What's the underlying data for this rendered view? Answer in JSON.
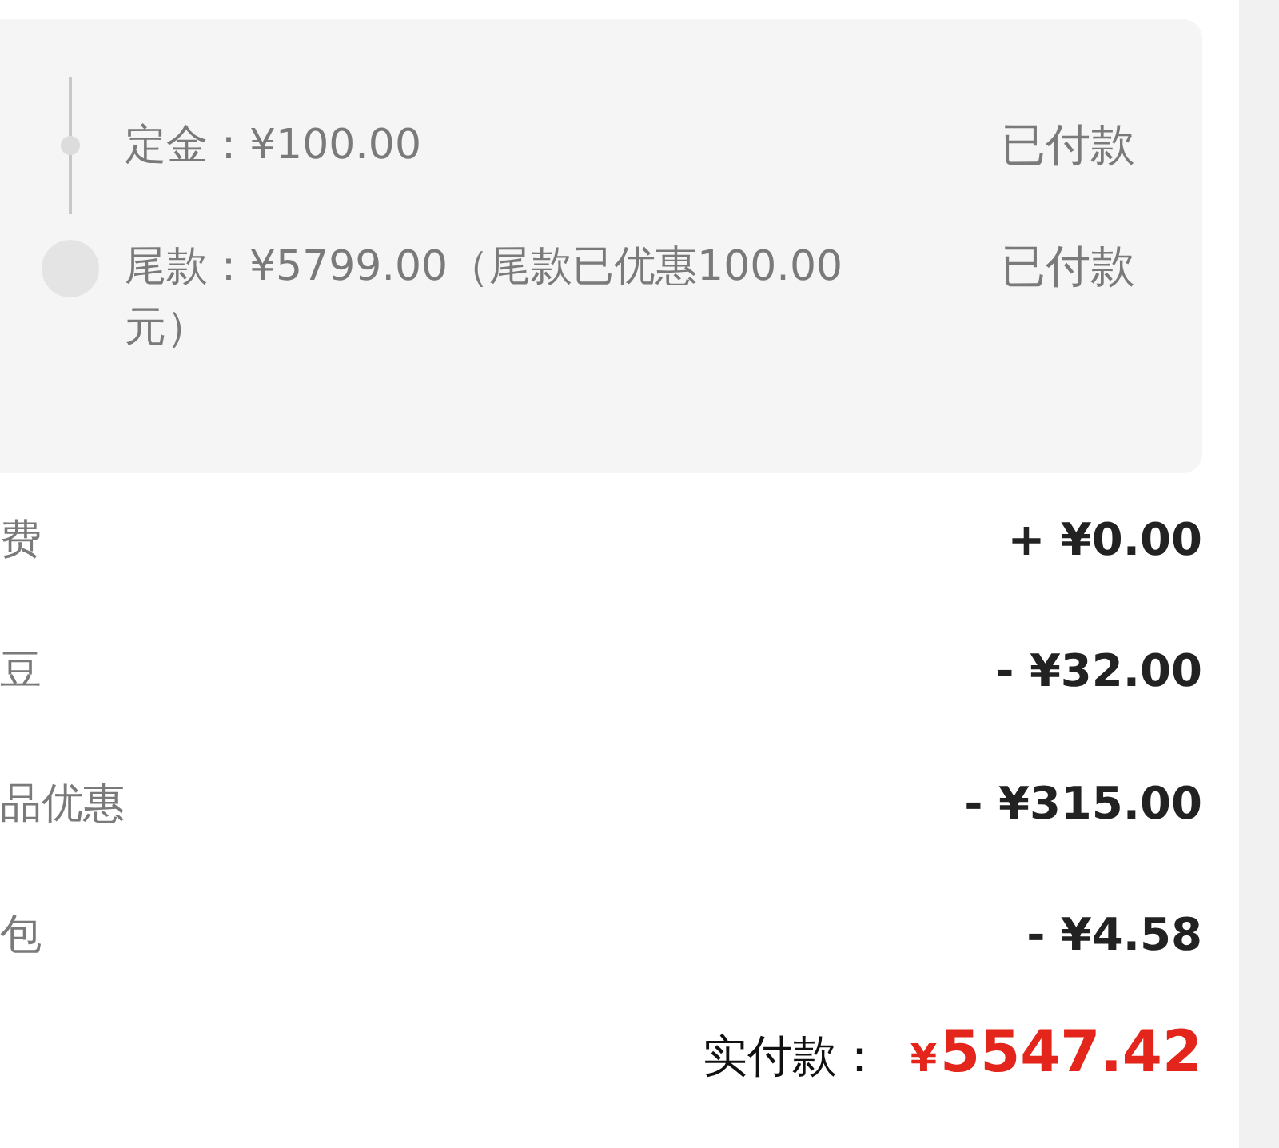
{
  "payments": [
    {
      "kind": "dot",
      "text": "定金：¥100.00",
      "status": "已付款"
    },
    {
      "kind": "circle",
      "text": "尾款：¥5799.00（尾款已优惠100.00元）",
      "status": "已付款"
    }
  ],
  "fees": [
    {
      "label": "费",
      "value": "+ ¥0.00"
    },
    {
      "label": "豆",
      "value": "- ¥32.00"
    },
    {
      "label": "品优惠",
      "value": "- ¥315.00"
    },
    {
      "label": "包",
      "value": "- ¥4.58"
    }
  ],
  "total": {
    "label": "实付款：",
    "currency": "¥",
    "amount": "5547.42"
  }
}
